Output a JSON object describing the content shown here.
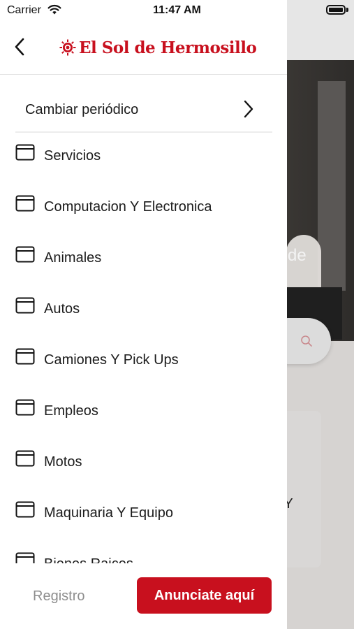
{
  "status_bar": {
    "carrier": "Carrier",
    "time": "11:47 AM"
  },
  "header": {
    "logo_text": "El Sol de Hermosillo"
  },
  "change_newspaper": {
    "label": "Cambiar periódico"
  },
  "menu": {
    "items": [
      {
        "label": "Servicios"
      },
      {
        "label": "Computacion Y Electronica"
      },
      {
        "label": "Animales"
      },
      {
        "label": "Autos"
      },
      {
        "label": "Camiones Y Pick Ups"
      },
      {
        "label": "Empleos"
      },
      {
        "label": "Motos"
      },
      {
        "label": "Maquinaria Y Equipo"
      },
      {
        "label": "Bienes Raices"
      }
    ]
  },
  "footer": {
    "register_label": "Registro",
    "cta_label": "Anunciate aquí"
  },
  "background": {
    "hero_text": "os de",
    "card_text": "n Y"
  },
  "colors": {
    "brand_red": "#c8101e",
    "text": "#1c1c1c",
    "muted": "#8e8e8e"
  }
}
